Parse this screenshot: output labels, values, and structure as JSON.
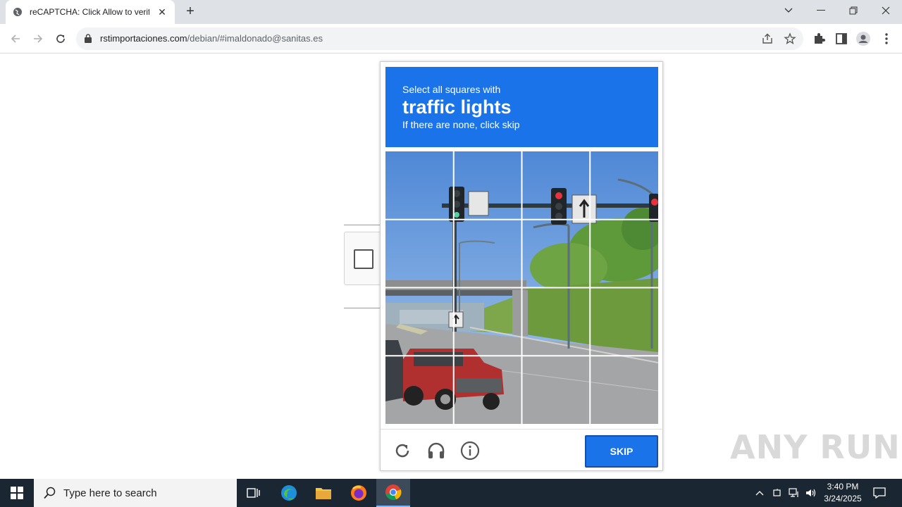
{
  "browser": {
    "tab_title": "reCAPTCHA: Click Allow to verify",
    "url_domain": "rstimportaciones.com",
    "url_rest": "/debian/#imaldonado@sanitas.es"
  },
  "captcha": {
    "instruction": "Select all squares with",
    "target": "traffic lights",
    "hint": "If there are none, click skip",
    "skip_label": "SKIP",
    "header_color": "#1a73e8"
  },
  "watermark": "ANY RUN",
  "taskbar": {
    "search_placeholder": "Type here to search",
    "time": "3:40 PM",
    "date": "3/24/2025"
  }
}
